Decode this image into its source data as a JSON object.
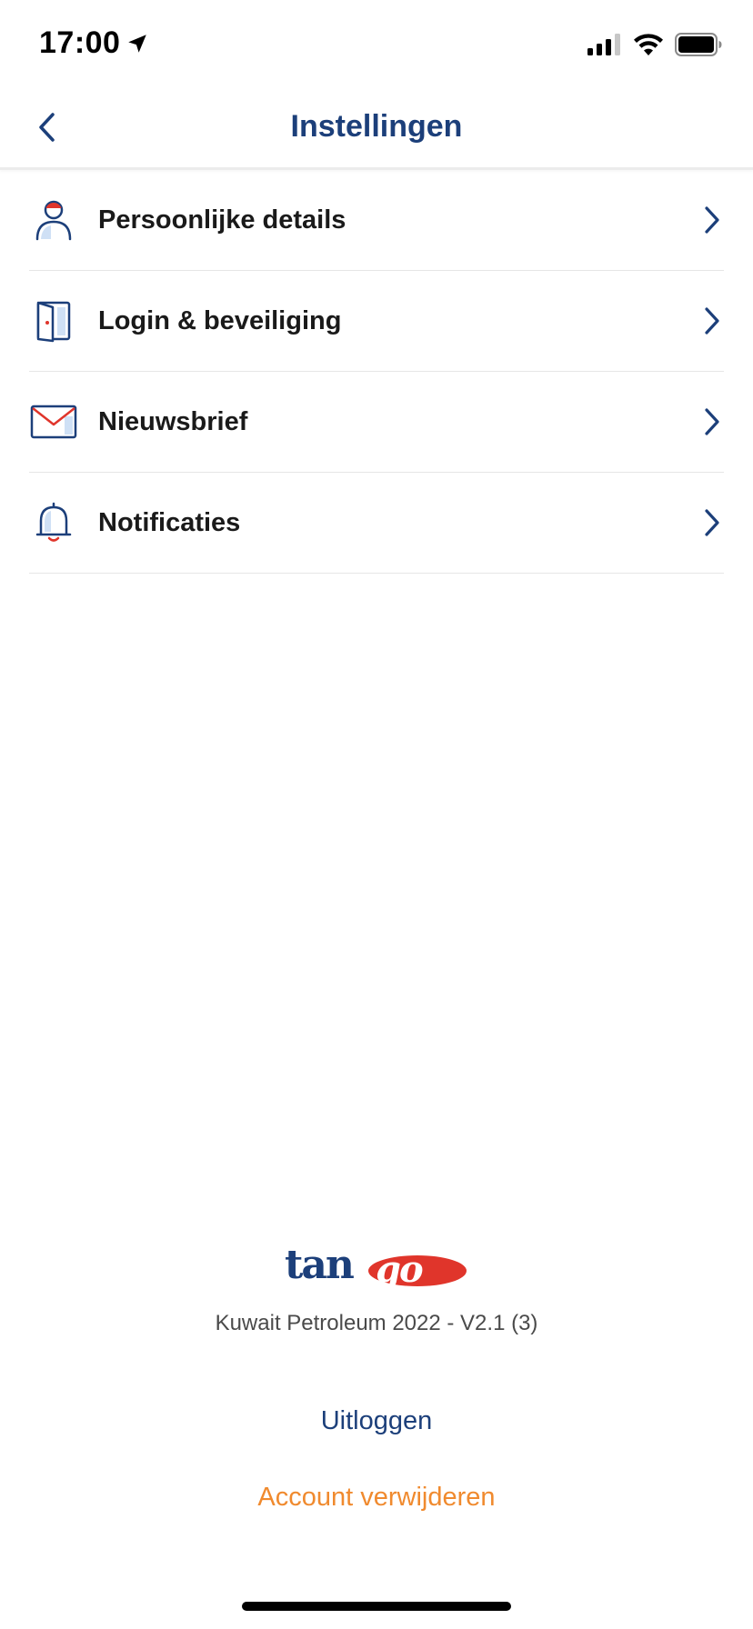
{
  "status_bar": {
    "time": "17:00",
    "location_icon": "location-arrow-icon",
    "signal_icon": "cellular-signal-icon",
    "wifi_icon": "wifi-icon",
    "battery_icon": "battery-icon"
  },
  "nav": {
    "title": "Instellingen",
    "back_icon": "chevron-left-icon"
  },
  "settings": {
    "items": [
      {
        "label": "Persoonlijke details",
        "icon": "person-icon"
      },
      {
        "label": "Login & beveiliging",
        "icon": "door-icon"
      },
      {
        "label": "Nieuwsbrief",
        "icon": "envelope-icon"
      },
      {
        "label": "Notificaties",
        "icon": "bell-icon"
      }
    ]
  },
  "footer": {
    "logo_text": "tango",
    "version": "Kuwait Petroleum 2022 - V2.1 (3)",
    "logout_label": "Uitloggen",
    "delete_label": "Account verwijderen"
  },
  "colors": {
    "primary_blue": "#1c3f7a",
    "accent_red": "#e0352b",
    "accent_orange": "#f08a2e",
    "divider": "#e6e6e6"
  }
}
